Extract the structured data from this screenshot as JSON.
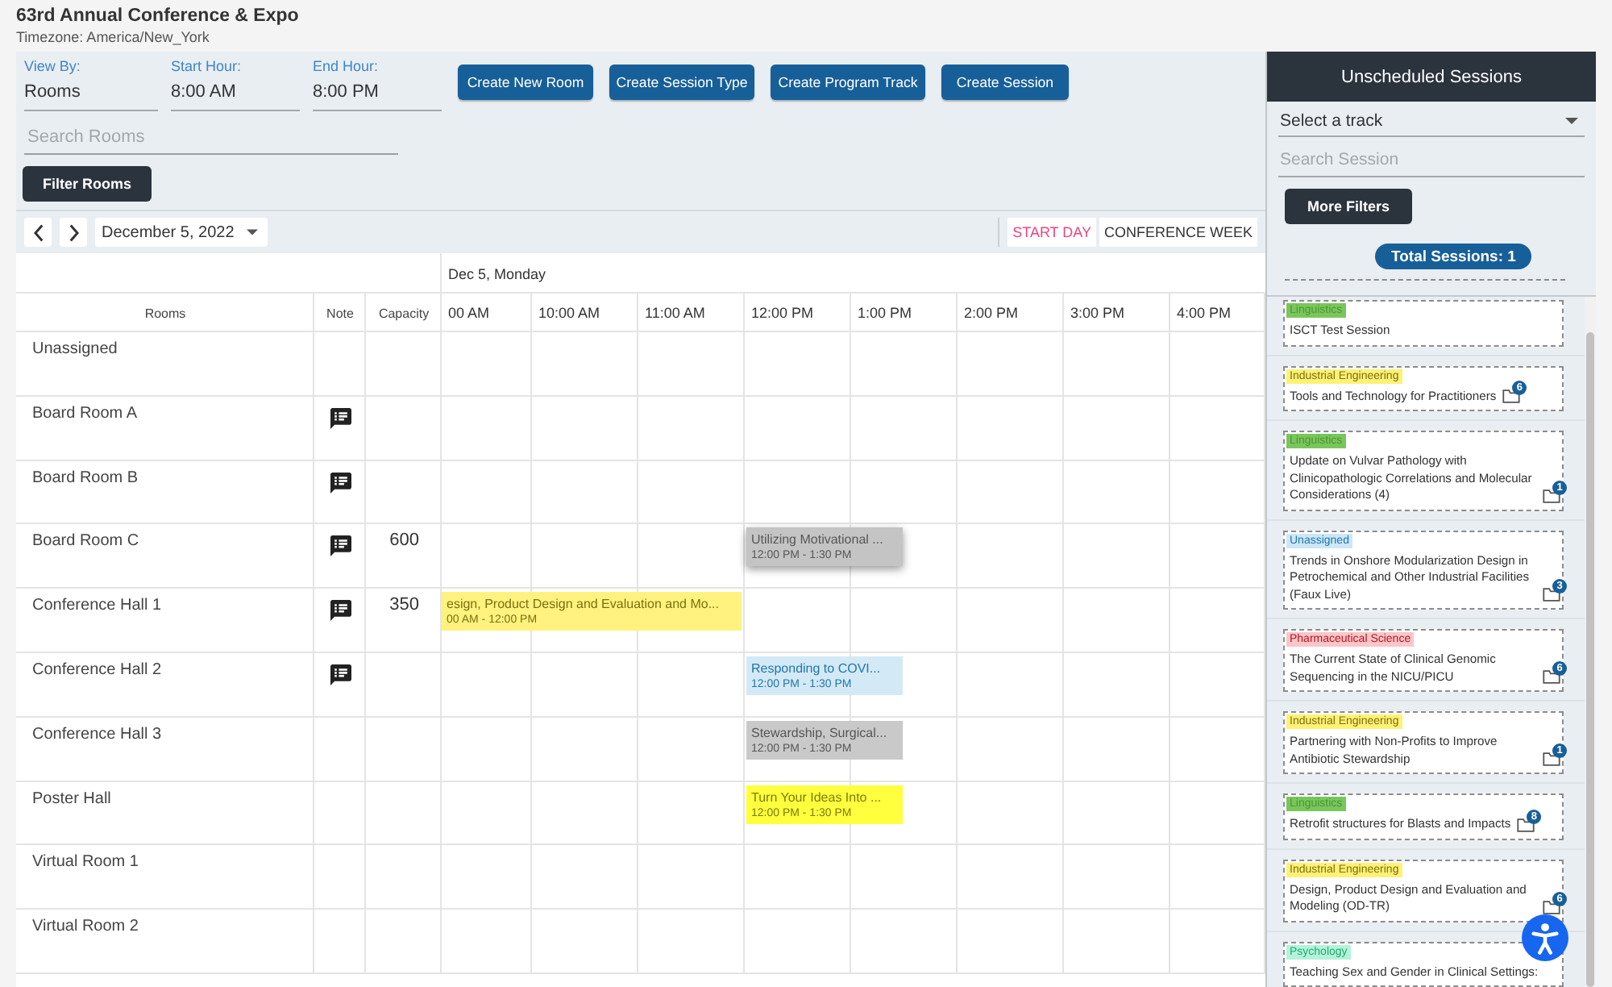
{
  "header": {
    "title": "63rd Annual Conference & Expo",
    "timezone": "Timezone: America/New_York"
  },
  "filters": {
    "fields": [
      {
        "label": "View By:",
        "value": "Rooms"
      },
      {
        "label": "Start Hour:",
        "value": "8:00 AM"
      },
      {
        "label": "End Hour:",
        "value": "8:00 PM"
      }
    ],
    "actions": [
      "Create New Room",
      "Create Session Type",
      "Create Program Track",
      "Create Session"
    ],
    "search": {
      "placeholder": "Search Rooms"
    },
    "filter_button": "Filter Rooms"
  },
  "calendar_nav": {
    "date": "December 5, 2022",
    "view_modes": [
      {
        "label": "START DAY",
        "selected": true
      },
      {
        "label": "CONFERENCE WEEK",
        "selected": false
      }
    ]
  },
  "grid": {
    "day": "Dec 5, Monday",
    "columns": [
      "Rooms",
      "Note",
      "Capacity"
    ],
    "hours": [
      "00 AM",
      "10:00 AM",
      "11:00 AM",
      "12:00 PM",
      "1:00 PM",
      "2:00 PM",
      "3:00 PM",
      "4:00 PM"
    ],
    "rooms": [
      {
        "name": "Unassigned",
        "note": false
      },
      {
        "name": "Board Room A",
        "note": true
      },
      {
        "name": "Board Room B",
        "note": true
      },
      {
        "name": "Board Room C",
        "note": true,
        "capacity": "600",
        "sessions": [
          {
            "kind": "noon",
            "title": "Utilizing Motivational ...",
            "time": "12:00 PM - 1:30 PM",
            "color": "#c4c4c4",
            "selected": true
          }
        ]
      },
      {
        "name": "Conference Hall 1",
        "note": true,
        "capacity": "350",
        "sessions": [
          {
            "kind": "morning",
            "title": "esign, Product Design and Evaluation and Mo...",
            "time": "00 AM - 12:00 PM",
            "color": "#fff27f",
            "selected": false
          }
        ]
      },
      {
        "name": "Conference Hall 2",
        "note": true,
        "sessions": [
          {
            "kind": "noon",
            "title": "Responding to COVI...",
            "time": "12:00 PM - 1:30 PM",
            "color": "#d3e9f6",
            "selected": false
          }
        ]
      },
      {
        "name": "Conference Hall 3",
        "note": false,
        "sessions": [
          {
            "kind": "noon",
            "title": "Stewardship, Surgical...",
            "time": "12:00 PM - 1:30 PM",
            "color": "#c9c9c9",
            "selected": false
          }
        ]
      },
      {
        "name": "Poster Hall",
        "note": false,
        "sessions": [
          {
            "kind": "noon",
            "title": "Turn Your Ideas Into ...",
            "time": "12:00 PM - 1:30 PM",
            "color": "#ffff3d",
            "selected": false
          }
        ]
      },
      {
        "name": "Virtual Room 1",
        "note": false
      },
      {
        "name": "Virtual Room 2",
        "note": false
      }
    ]
  },
  "panel": {
    "title": "Unscheduled Sessions",
    "track_select": {
      "value": "Select a track"
    },
    "search": {
      "placeholder": "Search Session"
    },
    "more_filters": "More Filters",
    "total": "Total Sessions: 1",
    "sessions": [
      {
        "track": "Linguistics",
        "color": "#79c65c",
        "title": "ISCT Test Session"
      },
      {
        "track": "Industrial Engineering",
        "color": "#fff176",
        "title": "Tools and Technology for Practitioners",
        "files": "6"
      },
      {
        "track": "Linguistics",
        "color": "#79c65c",
        "title": "Update on Vulvar Pathology with Clinicopathologic Correlations and Molecular Considerations (4)",
        "files": "1"
      },
      {
        "track": "Unassigned",
        "color": "#cde7f6",
        "title": "Trends in Onshore Modularization Design in Petrochemical and Other Industrial Facilities (Faux Live)",
        "files": "3"
      },
      {
        "track": "Pharmaceutical Science",
        "color": "#fbc6c9",
        "title": "The Current State of Clinical Genomic Sequencing in the NICU/PICU",
        "files": "6"
      },
      {
        "track": "Industrial Engineering",
        "color": "#fff176",
        "title": "Partnering with Non-Profits to Improve Antibiotic Stewardship",
        "files": "1"
      },
      {
        "track": "Linguistics",
        "color": "#79c65c",
        "title": "Retrofit structures for Blasts and Impacts",
        "files": "8"
      },
      {
        "track": "Industrial Engineering",
        "color": "#fff176",
        "title": "Design, Product Design and Evaluation and Modeling (OD-TR)",
        "files": "6"
      },
      {
        "track": "Psychology",
        "color": "#b5f2da",
        "title": "Teaching Sex and Gender in Clinical Settings:"
      }
    ]
  }
}
